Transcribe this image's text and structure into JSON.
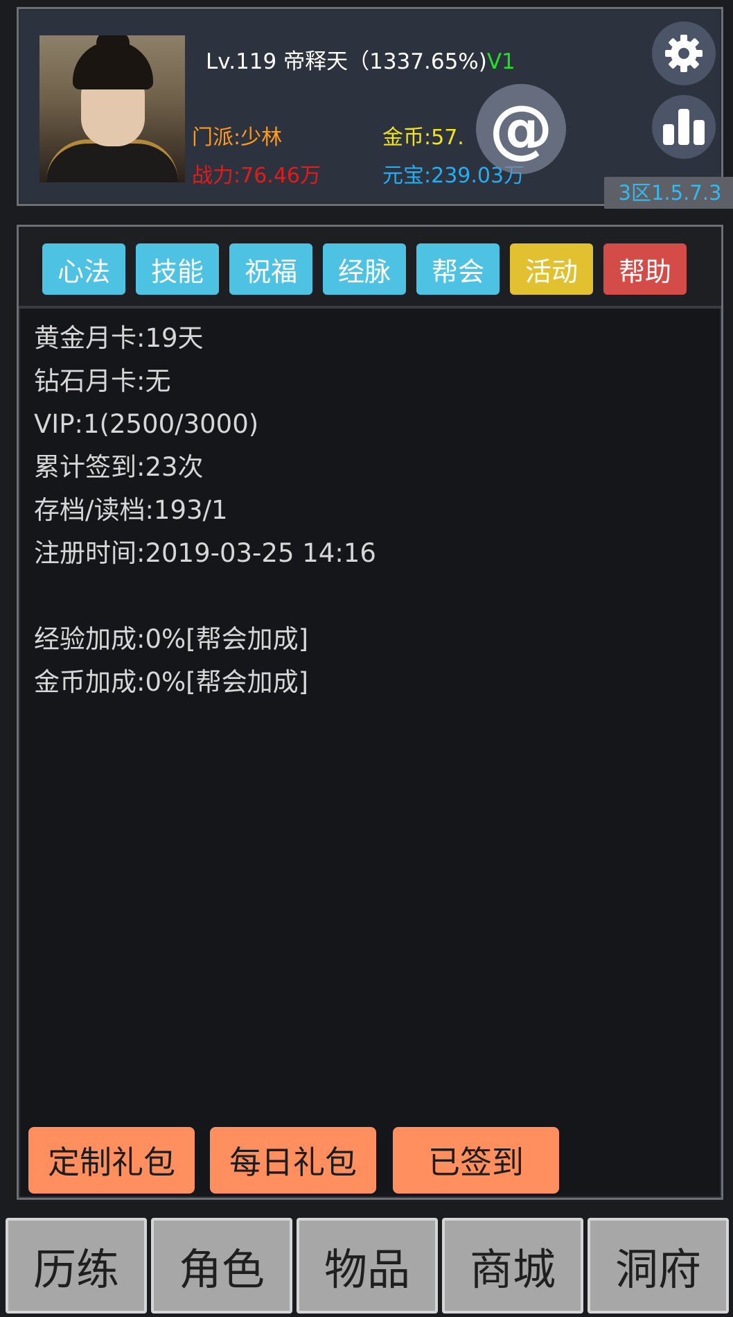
{
  "header": {
    "level": "Lv.119",
    "player_name": "帝释天",
    "exp_percent": "（1337.65%)",
    "vip_tag": "V1",
    "sect": "门派:少林",
    "power": "战力:76.46万",
    "gold": "金币:57.",
    "yuanbao": "元宝:239.03万",
    "server": "3区1.5.7.3",
    "at_symbol": "@",
    "icons": [
      "gear-icon",
      "bar-chart-icon",
      "at-icon"
    ]
  },
  "tabs": [
    {
      "label": "心法",
      "color": "#4ec2e2"
    },
    {
      "label": "技能",
      "color": "#4ec2e2"
    },
    {
      "label": "祝福",
      "color": "#4ec2e2"
    },
    {
      "label": "经脉",
      "color": "#4ec2e2"
    },
    {
      "label": "帮会",
      "color": "#4ec2e2"
    },
    {
      "label": "活动",
      "color": "#e2c131"
    },
    {
      "label": "帮助",
      "color": "#d44c48"
    }
  ],
  "info": {
    "gold_card": "黄金月卡:19天",
    "diamond_card": "钻石月卡:无",
    "vip": "VIP:1(2500/3000)",
    "signin_total": "累计签到:23次",
    "save_load": "存档/读档:193/1",
    "register_time": "注册时间:2019-03-25 14:16",
    "exp_bonus": "经验加成:0%[帮会加成]",
    "gold_bonus": "金币加成:0%[帮会加成]"
  },
  "actions": {
    "custom_gift": "定制礼包",
    "daily_gift": "每日礼包",
    "signed_in": "已签到"
  },
  "bottom_nav": [
    "历练",
    "角色",
    "物品",
    "商城",
    "洞府"
  ],
  "colors": {
    "sect": "#ff9a1a",
    "power": "#e21b1b",
    "gold": "#f3e51d",
    "yuanbao": "#24aef2",
    "vip_tag": "#22e02a",
    "action_button": "#ff8f5f"
  }
}
